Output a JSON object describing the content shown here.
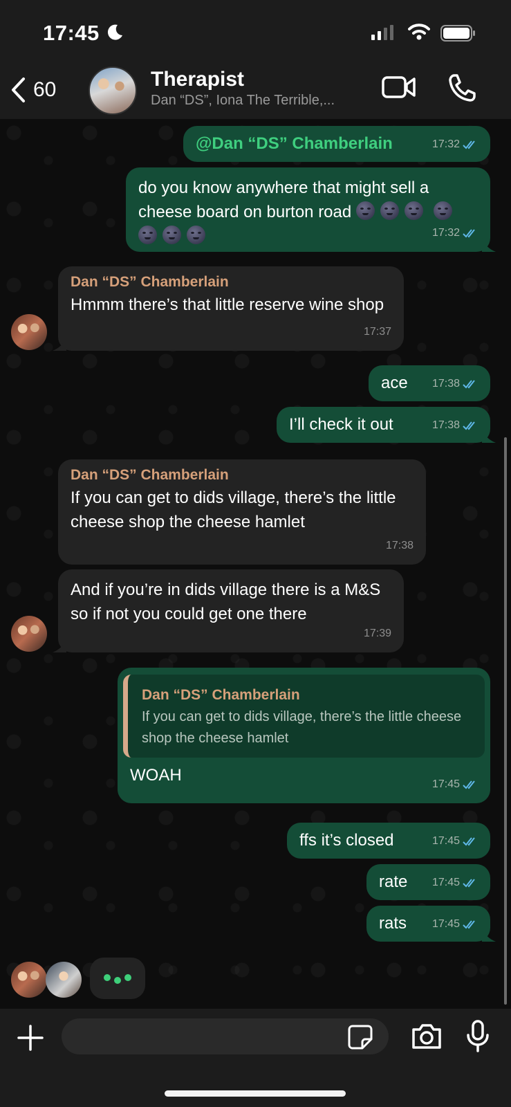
{
  "status_bar": {
    "time": "17:45"
  },
  "header": {
    "back_count": "60",
    "title": "Therapist",
    "members": "Dan “DS”, Iona The Terrible,..."
  },
  "messages": [
    {
      "dir": "out",
      "mention": "@Dan “DS” Chamberlain",
      "time": "17:32"
    },
    {
      "dir": "out",
      "text": "do you know anywhere that might sell a cheese board on burton road",
      "time": "17:32"
    },
    {
      "dir": "in",
      "sender": "Dan “DS” Chamberlain",
      "text": "Hmmm there’s that little reserve wine shop",
      "time": "17:37"
    },
    {
      "dir": "out",
      "text": "ace",
      "time": "17:38"
    },
    {
      "dir": "out",
      "text": "I’ll check it out",
      "time": "17:38"
    },
    {
      "dir": "in",
      "sender": "Dan “DS” Chamberlain",
      "text": "If you can get to dids village, there’s the little cheese shop the cheese hamlet",
      "time": "17:38"
    },
    {
      "dir": "in",
      "text": "And if you’re in dids village there is a M&S so if not you could get one there",
      "time": "17:39"
    },
    {
      "dir": "out",
      "quote_sender": "Dan “DS” Chamberlain",
      "quote_text": "If you can get to dids village, there’s the little cheese shop the cheese hamlet",
      "text": "WOAH",
      "time": "17:45"
    },
    {
      "dir": "out",
      "text": "ffs it’s closed",
      "time": "17:45"
    },
    {
      "dir": "out",
      "text": "rate",
      "time": "17:45"
    },
    {
      "dir": "out",
      "text": "rats",
      "time": "17:45"
    }
  ],
  "input": {
    "value": "",
    "placeholder": ""
  },
  "colors": {
    "outgoing_bubble": "#144d37",
    "incoming_bubble": "#232323",
    "sender_name": "#d6a07a",
    "mention": "#3fcf7f",
    "read_ticks": "#5fb8e8"
  }
}
